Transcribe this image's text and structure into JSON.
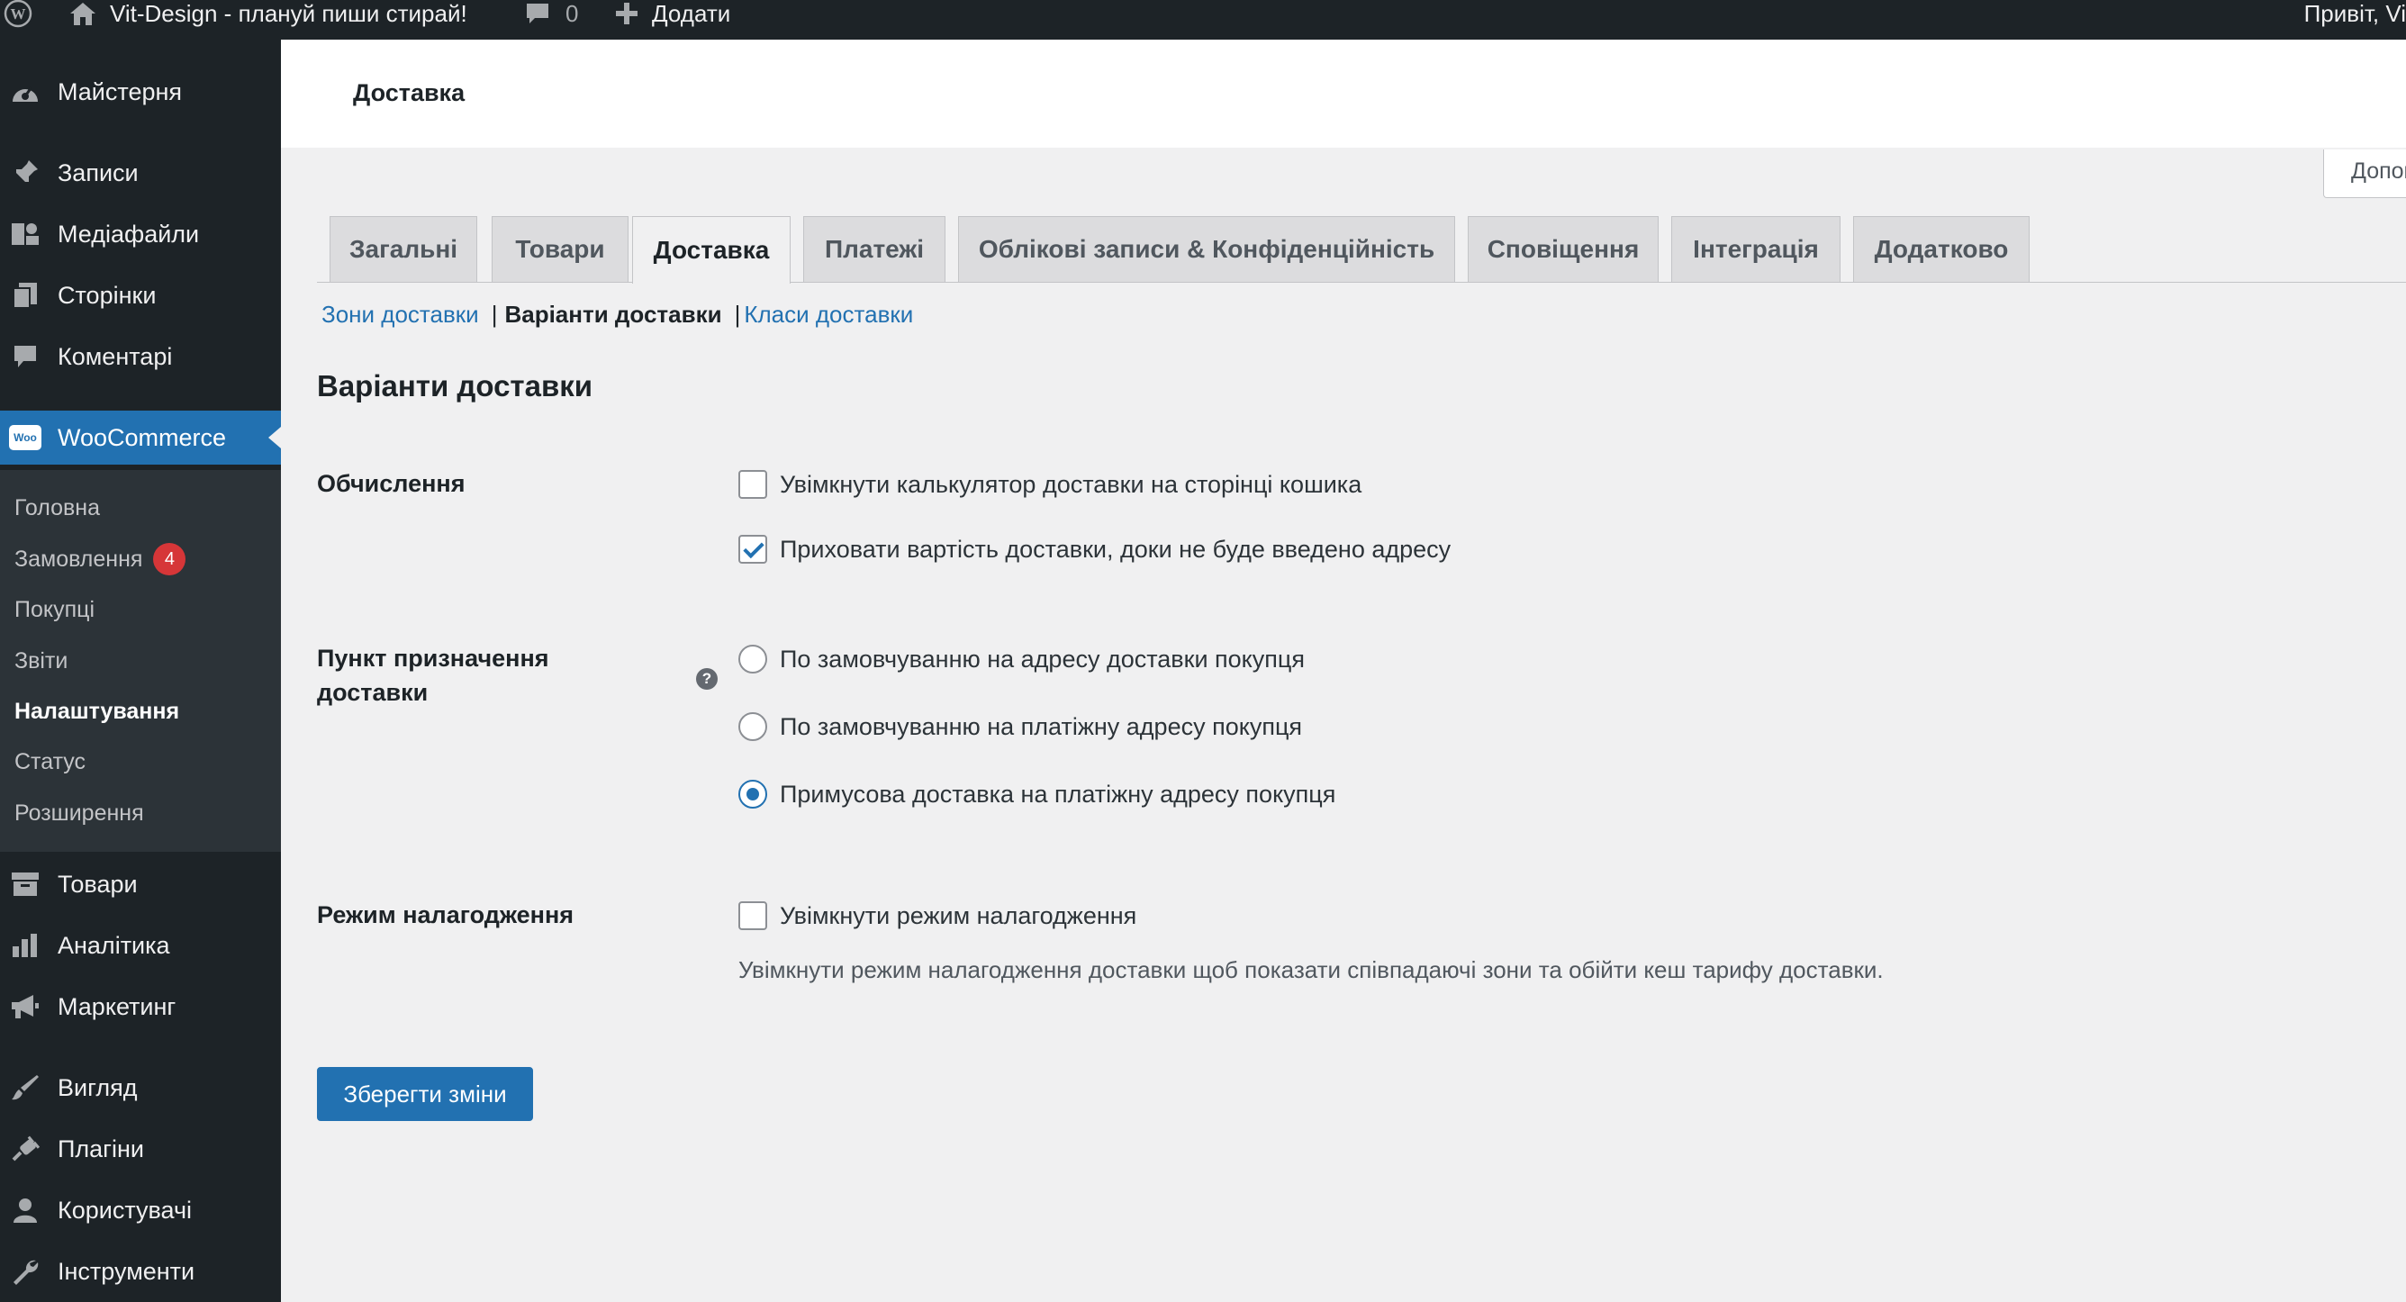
{
  "admin_bar": {
    "site_name": "Vit-Design - плануй пиши стирай!",
    "comments_count": "0",
    "new_label": "Додати",
    "howdy": "Привіт, Vi"
  },
  "sidebar": {
    "top_items": [
      {
        "label": "Майстерня",
        "icon": "dashboard-icon"
      },
      {
        "label": "Записи",
        "icon": "pin-icon"
      },
      {
        "label": "Медіафайли",
        "icon": "media-icon"
      },
      {
        "label": "Сторінки",
        "icon": "pages-icon"
      },
      {
        "label": "Коментарі",
        "icon": "comment-icon"
      },
      {
        "label": "WooCommerce",
        "icon": "woo-icon"
      }
    ],
    "woo_badge": "Woo",
    "submenu": [
      {
        "label": "Головна"
      },
      {
        "label": "Замовлення",
        "badge": "4"
      },
      {
        "label": "Покупці"
      },
      {
        "label": "Звіти"
      },
      {
        "label": "Налаштування"
      },
      {
        "label": "Статус"
      },
      {
        "label": "Розширення"
      }
    ],
    "bottom_items": [
      {
        "label": "Товари",
        "icon": "archive-icon"
      },
      {
        "label": "Аналітика",
        "icon": "chart-icon"
      },
      {
        "label": "Маркетинг",
        "icon": "megaphone-icon"
      },
      {
        "label": "Вигляд",
        "icon": "brush-icon"
      },
      {
        "label": "Плагіни",
        "icon": "plugin-icon"
      },
      {
        "label": "Користувачі",
        "icon": "user-icon"
      },
      {
        "label": "Інструменти",
        "icon": "wrench-icon"
      }
    ]
  },
  "header": {
    "title": "Доставка",
    "screen_options": "Допомога"
  },
  "tabs": [
    {
      "label": "Загальні"
    },
    {
      "label": "Товари"
    },
    {
      "label": "Доставка",
      "active": true
    },
    {
      "label": "Платежі"
    },
    {
      "label": "Облікові записи & Конфіденційність"
    },
    {
      "label": "Сповіщення"
    },
    {
      "label": "Інтеграція"
    },
    {
      "label": "Додатково"
    }
  ],
  "subsub": {
    "zones": "Зони доставки",
    "options": "Варіанти доставки",
    "classes": "Класи доставки",
    "sep": "|"
  },
  "section_title": "Варіанти доставки",
  "calc": {
    "label": "Обчислення",
    "opt1": "Увімкнути калькулятор доставки на сторінці кошика",
    "opt1_checked": false,
    "opt2": "Приховати вартість доставки, доки не буде введено адресу",
    "opt2_checked": true
  },
  "destination": {
    "label": "Пункт призначення доставки",
    "help": "?",
    "options": [
      "По замовчуванню на адресу доставки покупця",
      "По замовчуванню на платіжну адресу покупця",
      "Примусова доставка на платіжну адресу покупця"
    ],
    "selected": 2
  },
  "debug": {
    "label": "Режим налагодження",
    "opt": "Увімкнути режим налагодження",
    "checked": false,
    "description": "Увімкнути режим налагодження доставки щоб показати співпадаючі зони та обійти кеш тарифу доставки."
  },
  "save_label": "Зберегти зміни",
  "colors": {
    "admin_dark": "#1d2327",
    "accent": "#2271b1",
    "badge": "#d63638"
  }
}
